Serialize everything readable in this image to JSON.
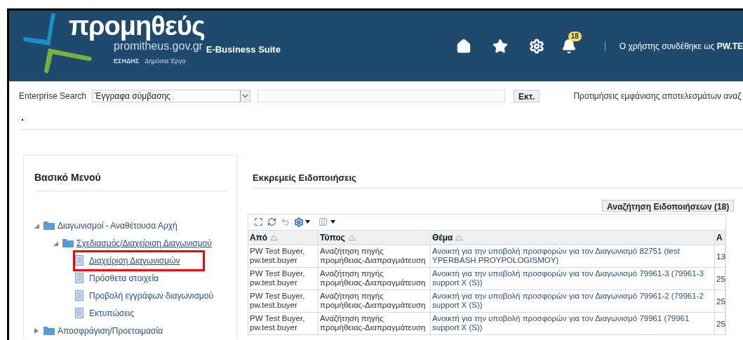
{
  "header": {
    "logo_name": "προμηθεύς",
    "logo_domain": "promitheus.gov.gr",
    "logo_system": "ΕΣΗΔΗΣ",
    "logo_subtitle": "Δημόσια Έργα",
    "suite": "E-Business Suite",
    "notifications_badge": "18",
    "user_text": "Ο χρήστης συνδέθηκε ως **PW.TE**"
  },
  "search": {
    "label": "Enterprise Search",
    "category": "Έγγραφα σύμβασης",
    "button": "Εκτ.",
    "preferences_link": "Προτιμήσεις εμφάνισης αποτελεσμάτων αναζ"
  },
  "dot": ".",
  "menu": {
    "title": "Βασικό Μενού",
    "items": [
      {
        "label": "Διαγωνισμοί - Αναθέτουσα Αρχή",
        "kind": "folder",
        "expanded": true,
        "children": [
          {
            "label": "Σχεδιασμός/Διαχείριση Διαγωνισμού",
            "kind": "folder",
            "expanded": true,
            "children": [
              {
                "label": "Διαχείριση Διαγωνισμών",
                "kind": "page",
                "highlighted": true
              },
              {
                "label": "Πρόσθετα στοιχεία",
                "kind": "page",
                "highlighted": false
              },
              {
                "label": "Προβολή εγγράφων διαγωνισμού",
                "kind": "page",
                "highlighted": false
              },
              {
                "label": "Εκτυπώσεις",
                "kind": "page",
                "highlighted": false
              }
            ]
          }
        ]
      },
      {
        "label": "Αποσφράγιση/Προετοιμασία",
        "kind": "folder",
        "expanded": false
      }
    ]
  },
  "notifications": {
    "title": "Εκκρεμείς Ειδοποιήσεις",
    "search_button": "Αναζήτηση Ειδοποιήσεων (18)",
    "columns": [
      "Από",
      "Τύπος",
      "Θέμα",
      "Α"
    ],
    "rows": [
      [
        "PW Test Buyer, pw.test.buyer",
        "Αναζήτηση πηγής προμήθειας-Διαπραγμάτευση",
        "Ανοικτή για την υποβολή προσφορών για τον Διαγωνισμό 82751 (test YPERBASH PROYPOLOGISMOY)",
        "13"
      ],
      [
        "PW Test Buyer, pw.test.buyer",
        "Αναζήτηση πηγής προμήθειας-Διαπραγμάτευση",
        "Ανοικτή για την υποβολή προσφορών για τον Διαγωνισμό 79961-3 (79961-3 support X (S))",
        "25"
      ],
      [
        "PW Test Buyer, pw.test.buyer",
        "Αναζήτηση πηγής προμήθειας-Διαπραγμάτευση",
        "Ανοικτή για την υποβολή προσφορών για τον Διαγωνισμό 79961-2 (79961-2 support X (S))",
        "25"
      ],
      [
        "PW Test Buyer, pw.test.buyer",
        "Αναζήτηση πηγής προμήθειας-Διαπραγμάτευση",
        "Ανοικτή για την υποβολή προσφορών για τον Διαγωνισμό 79961 (79961 support X (S))",
        "25"
      ]
    ]
  }
}
